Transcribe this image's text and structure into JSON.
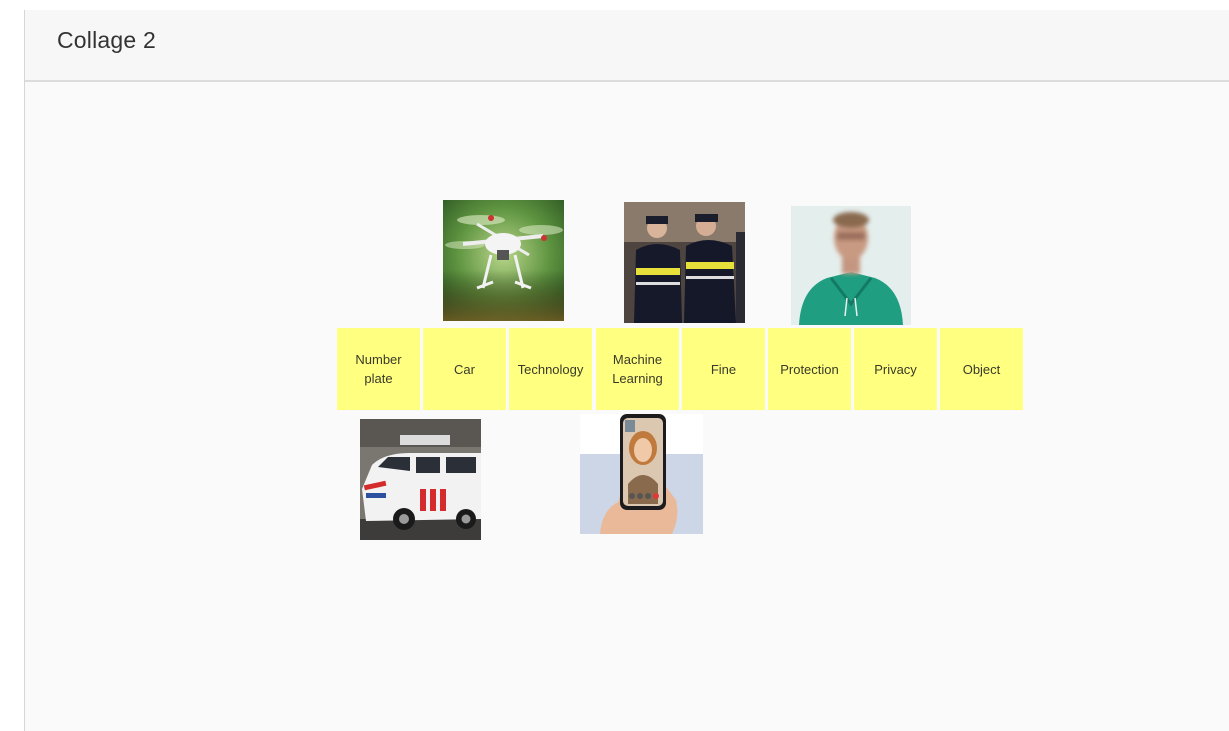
{
  "app": {
    "title": "Collage 2"
  },
  "notes": [
    {
      "label": "Number\nplate"
    },
    {
      "label": "Car"
    },
    {
      "label": "Technology"
    },
    {
      "label": "Machine\nLearning"
    },
    {
      "label": "Fine"
    },
    {
      "label": "Protection"
    },
    {
      "label": "Privacy"
    },
    {
      "label": "Object"
    }
  ],
  "images": {
    "drone": "drone-photo",
    "police": "police-officers-photo",
    "person": "blurred-person-photo",
    "car": "police-car-photo",
    "phone": "video-call-phone-photo"
  },
  "colors": {
    "sticky_note": "#ffff80",
    "background": "#fafafa"
  }
}
